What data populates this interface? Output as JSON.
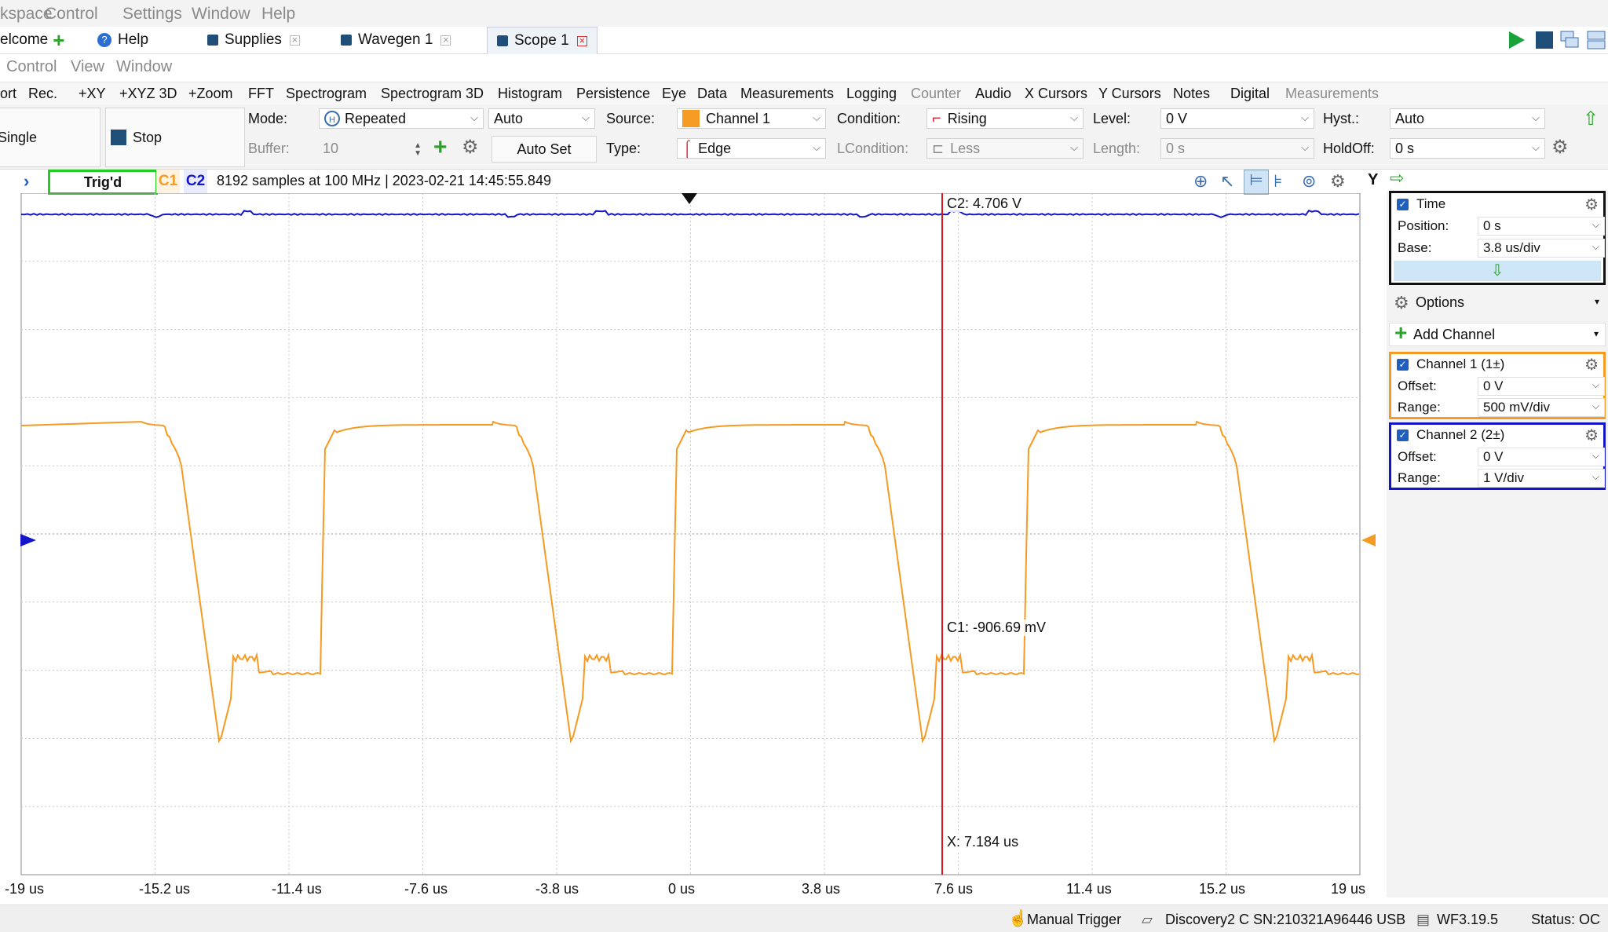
{
  "menu": [
    "kspace",
    "Control",
    "Settings",
    "Window",
    "Help"
  ],
  "tabs": [
    {
      "label": "elcome"
    },
    {
      "label": "Help"
    },
    {
      "label": "Supplies"
    },
    {
      "label": "Wavegen 1"
    },
    {
      "label": "Scope 1"
    }
  ],
  "submenu": [
    "Control",
    "View",
    "Window"
  ],
  "toolbar": [
    "ort",
    "Rec.",
    "+XY",
    "+XYZ 3D",
    "+Zoom",
    "FFT",
    "Spectrogram",
    "Spectrogram 3D",
    "Histogram",
    "Persistence",
    "Eye",
    "Data",
    "Measurements",
    "Logging",
    "Counter",
    "Audio",
    "X Cursors",
    "Y Cursors",
    "Notes",
    "Digital",
    "Measurements"
  ],
  "controls": {
    "single": "Single",
    "stop": "Stop",
    "mode_label": "Mode:",
    "mode_value": "Repeated",
    "mode_auto": "Auto",
    "buffer_label": "Buffer:",
    "buffer_value": "10",
    "autoset": "Auto Set",
    "source_label": "Source:",
    "source_value": "Channel 1",
    "type_label": "Type:",
    "type_value": "Edge",
    "condition_label": "Condition:",
    "condition_value": "Rising",
    "lcondition_label": "LCondition:",
    "lcondition_value": "Less",
    "level_label": "Level:",
    "level_value": "0 V",
    "length_label": "Length:",
    "length_value": "0 s",
    "hyst_label": "Hyst.:",
    "hyst_value": "Auto",
    "holdoff_label": "HoldOff:",
    "holdoff_value": "0 s"
  },
  "scope": {
    "trig_status": "Trig'd",
    "c1": "C1",
    "c2": "C2",
    "info": "8192 samples at 100 MHz | 2023-02-21 14:45:55.849",
    "y_button": "Y",
    "cursor_c2": "C2: 4.706 V",
    "cursor_c1": "C1: -906.69 mV",
    "cursor_x": "X: 7.184 us",
    "x_ticks": [
      "-19 us",
      "-15.2 us",
      "-11.4 us",
      "-7.6 us",
      "-3.8 us",
      "0 us",
      "3.8 us",
      "7.6 us",
      "11.4 us",
      "15.2 us",
      "19 us"
    ]
  },
  "side": {
    "time": {
      "title": "Time",
      "position_label": "Position:",
      "position_value": "0 s",
      "base_label": "Base:",
      "base_value": "3.8 us/div"
    },
    "options": "Options",
    "add_channel": "Add Channel",
    "ch1": {
      "title": "Channel 1 (1±)",
      "offset_label": "Offset:",
      "offset_value": "0 V",
      "range_label": "Range:",
      "range_value": "500 mV/div"
    },
    "ch2": {
      "title": "Channel 2 (2±)",
      "offset_label": "Offset:",
      "offset_value": "0 V",
      "range_label": "Range:",
      "range_value": "1 V/div"
    }
  },
  "status": {
    "manual": "Manual Trigger",
    "device": "Discovery2 C SN:210321A96446 USB",
    "version": "WF3.19.5",
    "state": "Status: OC"
  },
  "colors": {
    "ch1": "#f59a23",
    "ch2": "#1414c8",
    "cursor": "#e0141e",
    "accent": "#1f4e79",
    "trig_border": "#22cc22"
  }
}
